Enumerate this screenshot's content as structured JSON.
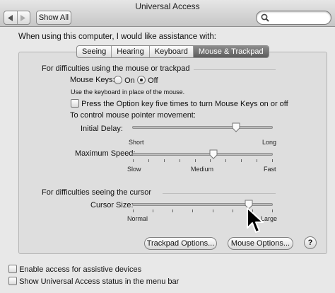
{
  "window": {
    "title": "Universal Access",
    "show_all_label": "Show All"
  },
  "search": {
    "value": "",
    "placeholder": ""
  },
  "intro": "When using this computer, I would like assistance with:",
  "tabs": [
    {
      "label": "Seeing",
      "active": false
    },
    {
      "label": "Hearing",
      "active": false
    },
    {
      "label": "Keyboard",
      "active": false
    },
    {
      "label": "Mouse & Trackpad",
      "active": true
    }
  ],
  "mouse_section": {
    "heading": "For difficulties using the mouse or trackpad",
    "mouse_keys_label": "Mouse Keys:",
    "on_label": "On",
    "off_label": "Off",
    "selected": "Off",
    "mouse_keys_hint": "Use the keyboard in place of the mouse.",
    "option_key_label": "Press the Option key five times to turn Mouse Keys on or off",
    "option_key_checked": false,
    "pointer_heading": "To control mouse pointer movement:",
    "initial_delay": {
      "label": "Initial Delay:",
      "min_label": "Short",
      "max_label": "Long",
      "level": 0.74
    },
    "max_speed": {
      "label": "Maximum Speed:",
      "min_label": "Slow",
      "mid_label": "Medium",
      "max_label": "Fast",
      "level": 0.58
    }
  },
  "cursor_section": {
    "heading": "For difficulties seeing the cursor",
    "cursor_size": {
      "label": "Cursor Size:",
      "min_label": "Normal",
      "max_label": "Large",
      "level": 0.83
    }
  },
  "buttons": {
    "trackpad_options": "Trackpad Options...",
    "mouse_options": "Mouse Options...",
    "help": "?"
  },
  "footer": {
    "assistive_label": "Enable access for assistive devices",
    "assistive_checked": false,
    "status_label": "Show Universal Access status in the menu bar",
    "status_checked": false
  }
}
